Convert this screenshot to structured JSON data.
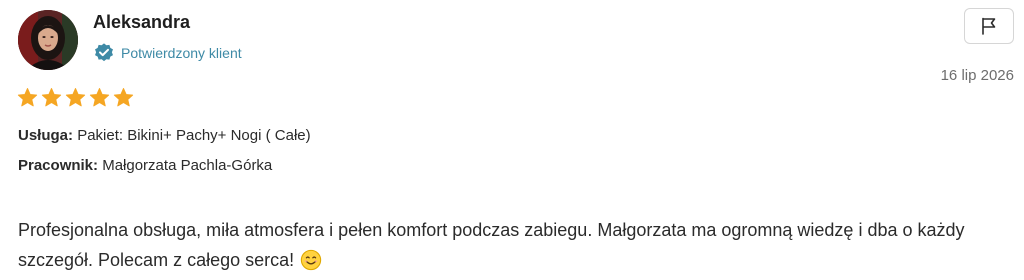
{
  "reviewer": {
    "name": "Aleksandra",
    "verified_label": "Potwierdzony klient",
    "avatar_icon": "profile-photo"
  },
  "review": {
    "date": "16 lip 2026",
    "rating": 5,
    "rating_max": 5,
    "service_label": "Usługa:",
    "service_value": "Pakiet: Bikini+ Pachy+ Nogi ( Całe)",
    "staff_label": "Pracownik:",
    "staff_value": "Małgorzata Pachla-Górka",
    "text": "Profesjonalna obsługa, miła atmosfera i pełen komfort podczas zabiegu. Małgorzata ma ogromną wiedzę i dba o każdy szczegół. Polecam z całego serca!",
    "emoji": "smiling-face-icon"
  },
  "actions": {
    "report_icon": "flag-icon"
  },
  "colors": {
    "star": "#f5a623",
    "verified": "#3e8aa6",
    "text": "#2b2b2b",
    "muted": "#6d6d6d",
    "border": "#d6d6d6"
  }
}
